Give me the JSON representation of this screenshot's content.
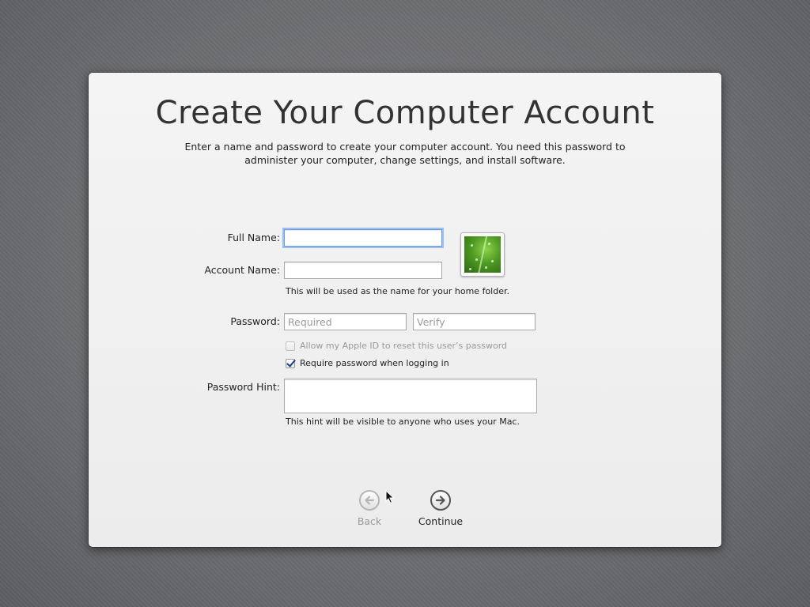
{
  "setup": {
    "title": "Create Your Computer Account",
    "subtitle": "Enter a name and password to create your computer account. You need this password to administer your computer, change settings, and install software."
  },
  "form": {
    "full_name_label": "Full Name:",
    "full_name_value": "",
    "account_name_label": "Account Name:",
    "account_name_value": "",
    "account_name_note": "This will be used as the name for your home folder.",
    "password_label": "Password:",
    "password_placeholder": "Required",
    "verify_placeholder": "Verify",
    "apple_id_reset_label": "Allow my Apple ID to reset this user’s password",
    "apple_id_reset_checked": false,
    "apple_id_reset_enabled": false,
    "require_password_label": "Require password when logging in",
    "require_password_checked": true,
    "hint_label": "Password Hint:",
    "hint_value": "",
    "hint_note": "This hint will be visible to anyone who uses your Mac."
  },
  "user_picture": {
    "icon": "leaf-picture-icon"
  },
  "navigation": {
    "back_label": "Back",
    "back_enabled": false,
    "continue_label": "Continue",
    "continue_enabled": true
  },
  "colors": {
    "focus_ring": "#9dc0f2",
    "checkbox_mark": "#1c3c8c"
  }
}
